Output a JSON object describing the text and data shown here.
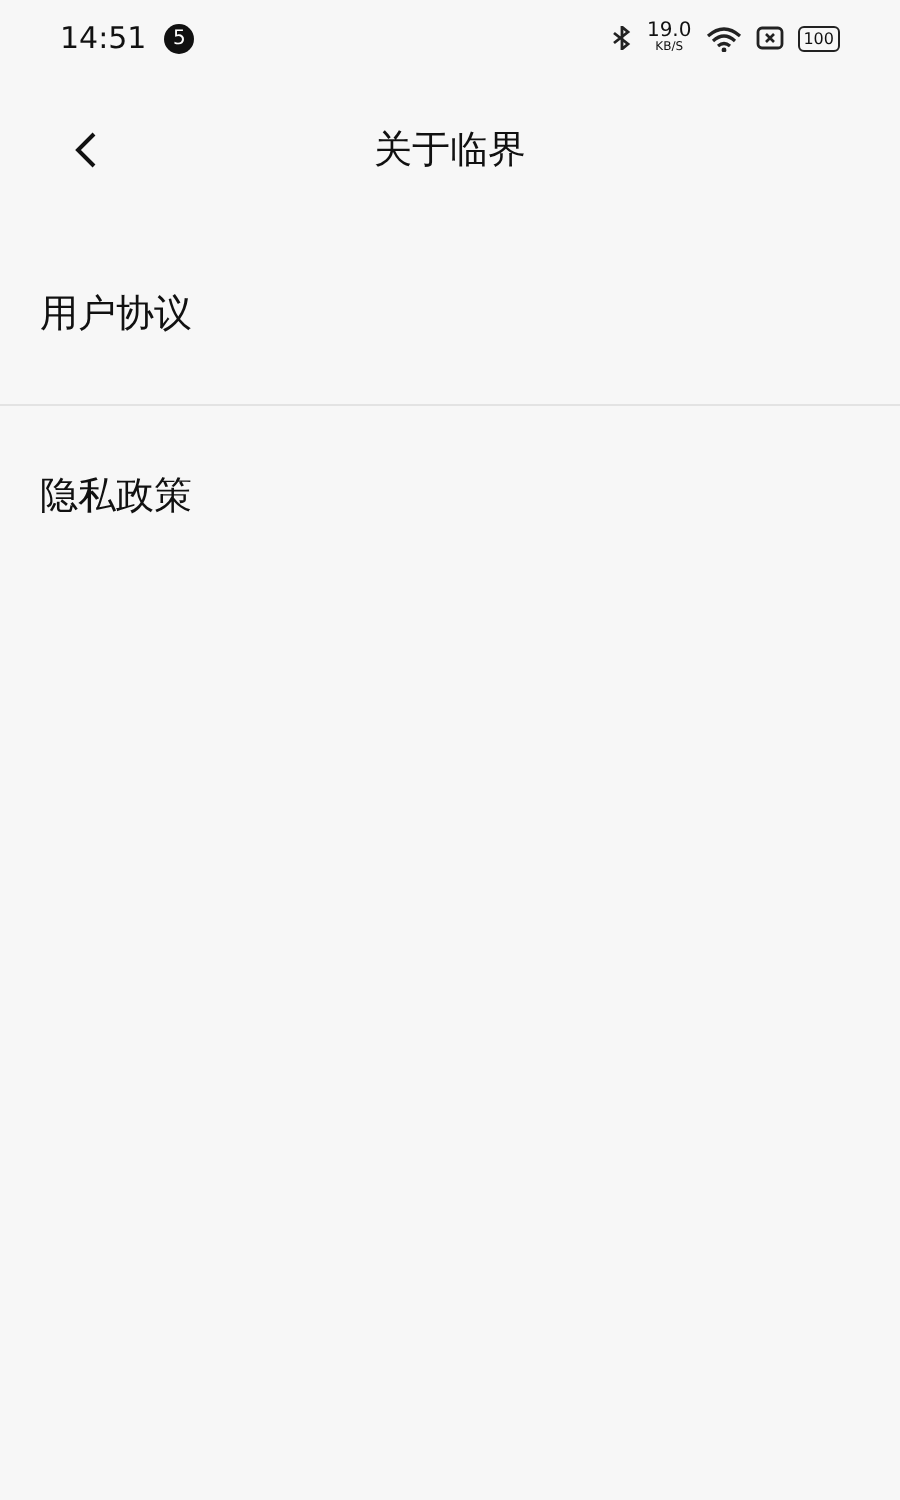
{
  "status_bar": {
    "time": "14:51",
    "notification_count": "5",
    "speed": "19.0",
    "speed_unit": "KB/S",
    "battery": "100"
  },
  "header": {
    "title": "关于临界"
  },
  "items": [
    {
      "label": "用户协议"
    },
    {
      "label": "隐私政策"
    }
  ]
}
